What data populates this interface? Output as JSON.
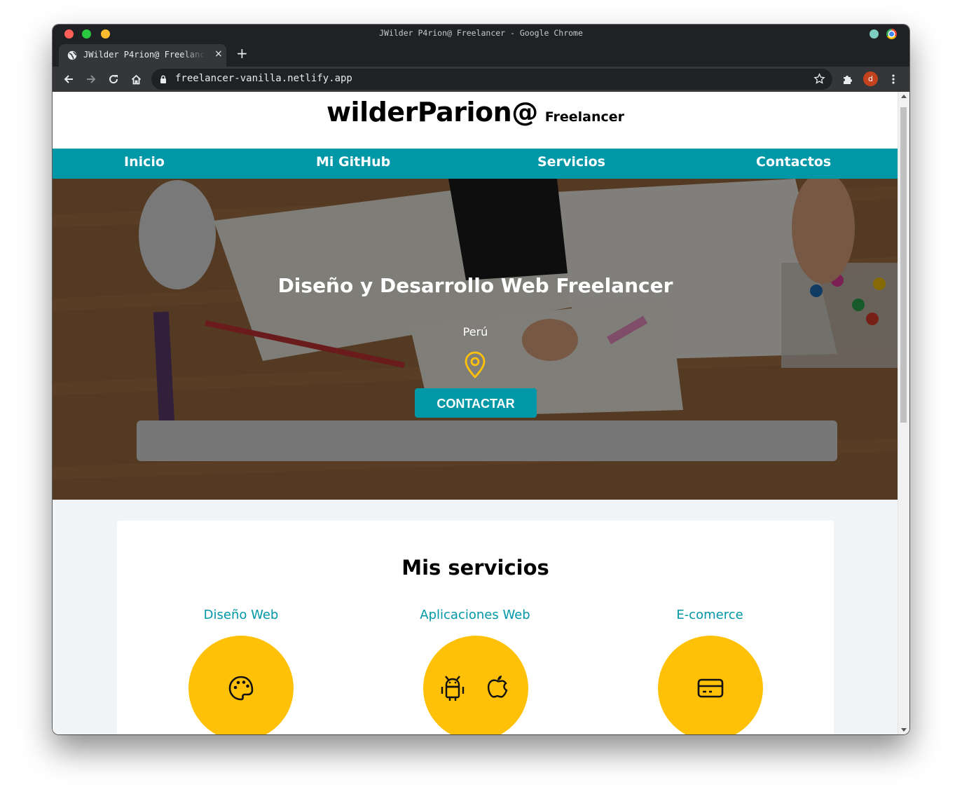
{
  "browser": {
    "window_title": "JWilder P4rion@ Freelancer - Google Chrome",
    "tab_title": "JWilder P4rion@ Freelancer",
    "url": "freelancer-vanilla.netlify.app",
    "avatar_letter": "d",
    "new_tab_symbol": "+",
    "tab_close_symbol": "×"
  },
  "header": {
    "brand": "wilderParion@",
    "subtitle": "Freelancer"
  },
  "nav": {
    "items": [
      {
        "label": "Inicio"
      },
      {
        "label": "Mi GitHub"
      },
      {
        "label": "Servicios"
      },
      {
        "label": "Contactos"
      }
    ]
  },
  "hero": {
    "title": "Diseño y Desarrollo Web Freelancer",
    "location": "Perú",
    "button": "CONTACTAR"
  },
  "services": {
    "title": "Mis servicios",
    "items": [
      {
        "name": "Diseño Web",
        "icon": "palette-icon"
      },
      {
        "name": "Aplicaciones Web",
        "icon": "android-apple-icon"
      },
      {
        "name": "E-comerce",
        "icon": "credit-card-icon"
      }
    ]
  },
  "colors": {
    "accent": "#0097a7",
    "circle": "#ffc107",
    "pin": "#ffc107"
  }
}
